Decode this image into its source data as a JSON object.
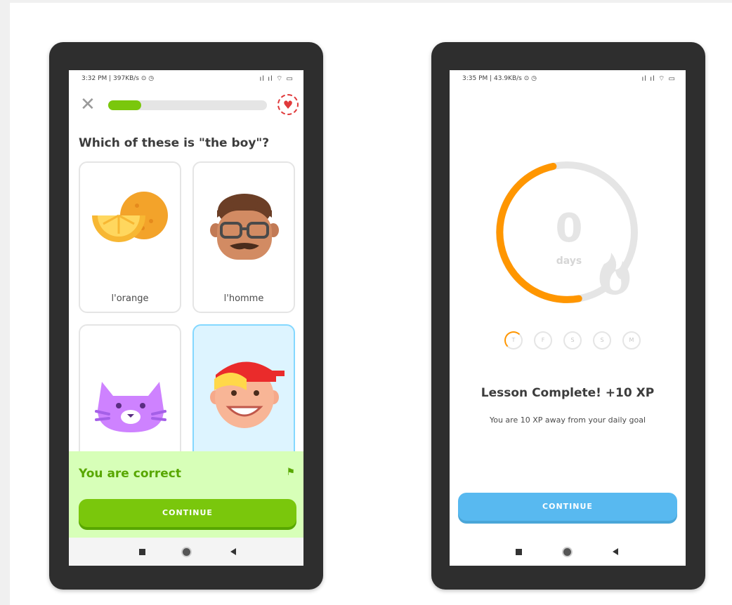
{
  "left_phone": {
    "status_time": "3:32 PM | 397KB/s ⊙ ◷",
    "status_icons": "ıl ıl ⌔ ▭",
    "progress_fraction": 0.21,
    "question": "Which of these is \"the boy\"?",
    "options": [
      {
        "label": "l'orange",
        "icon": "orange-icon",
        "selected": false
      },
      {
        "label": "l'homme",
        "icon": "man-icon",
        "selected": false
      },
      {
        "label": "",
        "icon": "cat-icon",
        "selected": false
      },
      {
        "label": "",
        "icon": "boy-icon",
        "selected": true
      }
    ],
    "feedback_title": "You are correct",
    "continue_label": "CONTINUE"
  },
  "right_phone": {
    "status_time": "3:35 PM | 43.9KB/s ⊙ ◷",
    "status_icons": "ıl ıl ⌔ ▭",
    "streak_number": "0",
    "streak_unit": "days",
    "streak_progress_fraction": 0.55,
    "days": [
      "T",
      "F",
      "S",
      "S",
      "M"
    ],
    "complete_title": "Lesson Complete! +10 XP",
    "complete_subtitle": "You are 10 XP away from your daily goal",
    "continue_label": "CONTINUE"
  },
  "colors": {
    "green": "#7ac70c",
    "feedback_bg": "#d7ffb8",
    "orange": "#ff9600",
    "blue": "#58b9f0"
  }
}
